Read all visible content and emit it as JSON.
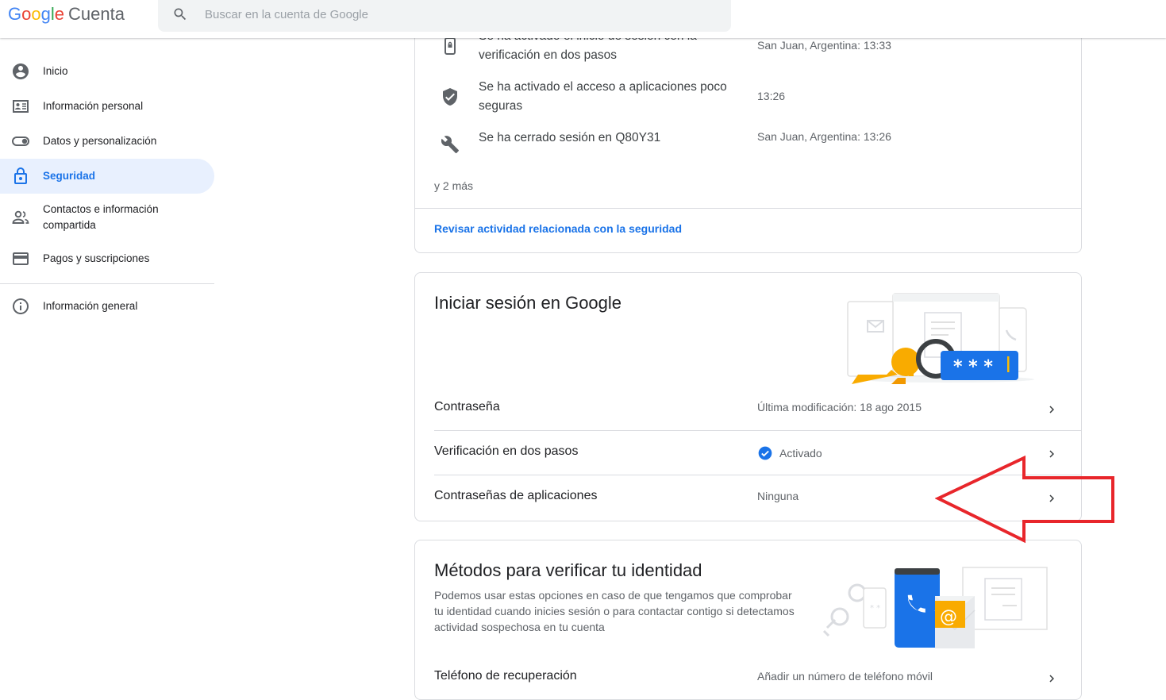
{
  "header": {
    "logo": {
      "g": "G",
      "o1": "o",
      "o2": "o",
      "g2": "g",
      "l": "l",
      "e": "e",
      "product": "Cuenta"
    },
    "search_placeholder": "Buscar en la cuenta de Google"
  },
  "sidebar": {
    "items": [
      {
        "label": "Inicio",
        "icon": "account-circle-icon"
      },
      {
        "label": "Información personal",
        "icon": "id-card-icon"
      },
      {
        "label": "Datos y personalización",
        "icon": "toggle-icon"
      },
      {
        "label": "Seguridad",
        "icon": "lock-icon",
        "active": true
      },
      {
        "label": "Contactos e información compartida",
        "icon": "people-icon"
      },
      {
        "label": "Pagos y suscripciones",
        "icon": "credit-card-icon"
      }
    ],
    "footer_item": {
      "label": "Información general",
      "icon": "info-icon"
    }
  },
  "security_events": {
    "events": [
      {
        "text": "Se ha activado el inicio de sesión con la verificación en dos pasos",
        "meta": "San Juan, Argentina: 13:33",
        "icon": "phone-lock-icon"
      },
      {
        "text": "Se ha activado el acceso a aplicaciones poco seguras",
        "meta": "13:26",
        "icon": "shield-check-icon"
      },
      {
        "text": "Se ha cerrado sesión en Q80Y31",
        "meta": "San Juan, Argentina: 13:26",
        "icon": "wrench-icon"
      }
    ],
    "more": "y 2 más",
    "link": "Revisar actividad relacionada con la seguridad"
  },
  "signin_card": {
    "title": "Iniciar sesión en Google",
    "rows": [
      {
        "label": "Contraseña",
        "value": "Última modificación: 18 ago 2015"
      },
      {
        "label": "Verificación en dos pasos",
        "value": "Activado",
        "status_icon": "check-circle-icon"
      },
      {
        "label": "Contraseñas de aplicaciones",
        "value": "Ninguna"
      }
    ]
  },
  "verify_card": {
    "title": "Métodos para verificar tu identidad",
    "description": "Podemos usar estas opciones en caso de que tengamos que comprobar tu identidad cuando inicies sesión o para contactar contigo si detectamos actividad sospechosa en tu cuenta",
    "rows": [
      {
        "label": "Teléfono de recuperación",
        "value": "Añadir un número de teléfono móvil"
      }
    ]
  },
  "colors": {
    "accent": "#1a73e8",
    "annotation_arrow": "#e8262b",
    "key": "#f9ab00",
    "active_bg": "#e8f0fe"
  }
}
